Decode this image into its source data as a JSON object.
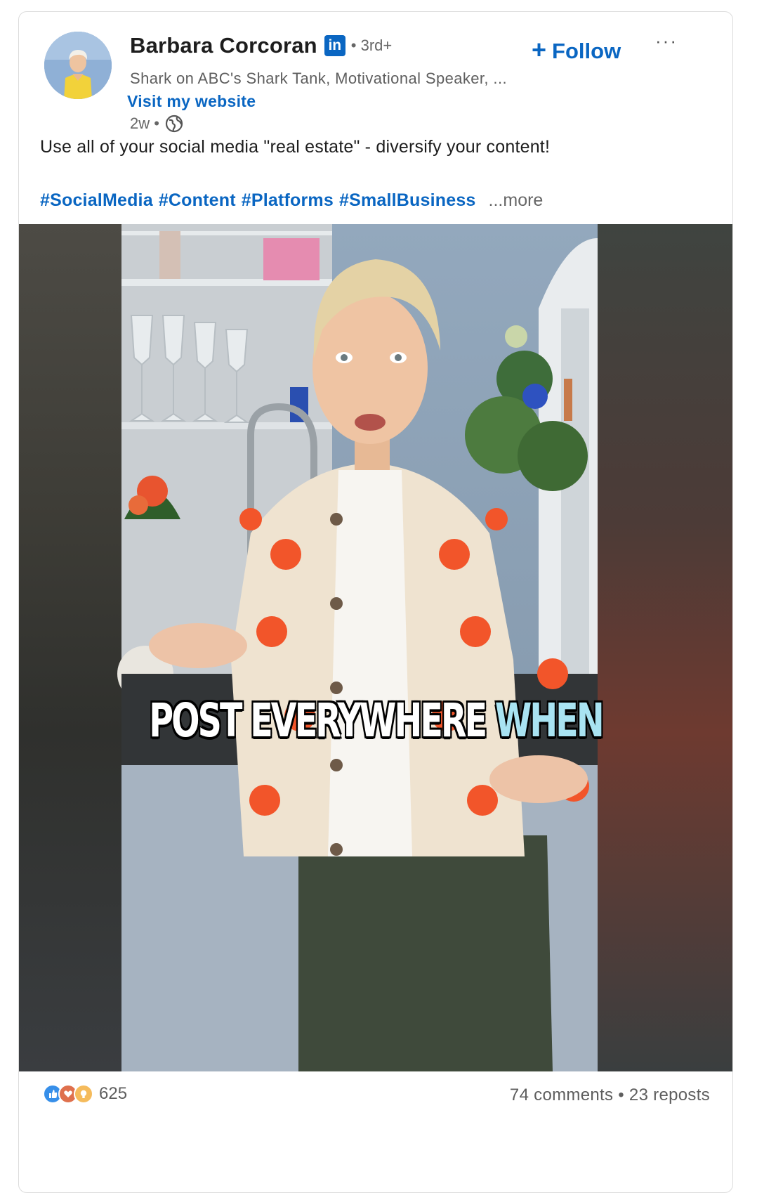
{
  "post": {
    "author": {
      "name": "Barbara Corcoran",
      "badge": "in",
      "degree": "• 3rd+",
      "headline": "Shark on ABC's Shark Tank, Motivational Speaker, ...",
      "website_link": "Visit my website",
      "time_ago": "2w •"
    },
    "follow_label": "Follow",
    "follow_plus": "+",
    "more_menu": "···",
    "text": "Use all of your social media \"real estate\" - diversify your content!",
    "hashtags": [
      "#SocialMedia",
      "#Content",
      "#Platforms",
      "#SmallBusiness"
    ],
    "see_more": "...more",
    "video": {
      "caption_main": "POST EVERYWHERE",
      "caption_highlight": "WHEN"
    },
    "social": {
      "reaction_count": "625",
      "comments": "74 comments",
      "separator": "•",
      "reposts": "23 reposts"
    }
  },
  "colors": {
    "link": "#0a66c2",
    "text": "#1d1d1d",
    "muted": "#666666",
    "caption_highlight": "#a9e3f2"
  },
  "icons": {
    "globe": "globe-icon",
    "like": "like-reaction-icon",
    "love": "love-reaction-icon",
    "insightful": "insightful-reaction-icon"
  }
}
